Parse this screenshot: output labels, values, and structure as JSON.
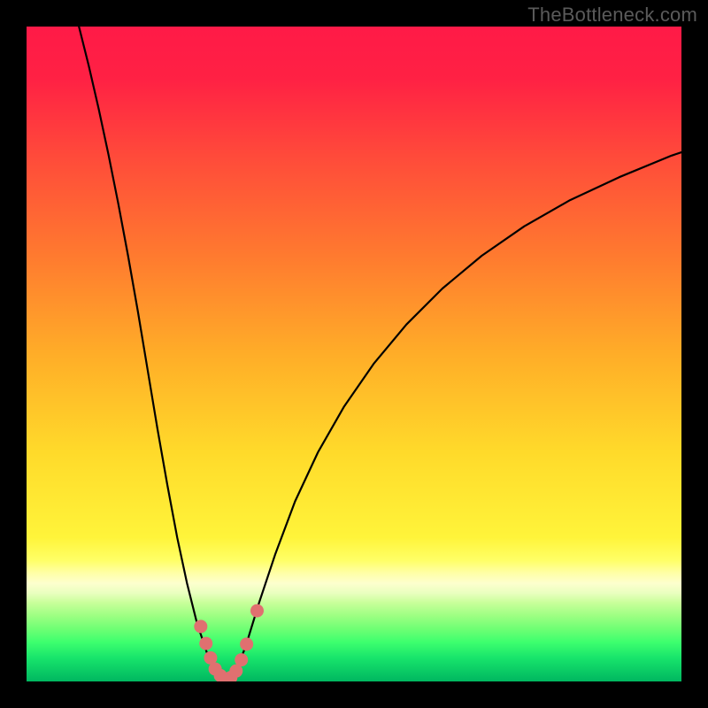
{
  "watermark": "TheBottleneck.com",
  "chart_data": {
    "type": "line",
    "title": "",
    "xlabel": "",
    "ylabel": "",
    "xlim": [
      0,
      100
    ],
    "ylim": [
      0,
      100
    ],
    "grid": false,
    "legend": false,
    "background_gradient": {
      "stops": [
        {
          "offset": 0.0,
          "color": "#ff1a47"
        },
        {
          "offset": 0.08,
          "color": "#ff2144"
        },
        {
          "offset": 0.2,
          "color": "#ff4b3a"
        },
        {
          "offset": 0.35,
          "color": "#ff7a2f"
        },
        {
          "offset": 0.5,
          "color": "#ffad28"
        },
        {
          "offset": 0.65,
          "color": "#ffda2a"
        },
        {
          "offset": 0.78,
          "color": "#fff43a"
        },
        {
          "offset": 0.815,
          "color": "#ffff66"
        },
        {
          "offset": 0.835,
          "color": "#ffffa8"
        },
        {
          "offset": 0.85,
          "color": "#fdffce"
        },
        {
          "offset": 0.865,
          "color": "#e9ffbf"
        },
        {
          "offset": 0.88,
          "color": "#c8ff9a"
        },
        {
          "offset": 0.9,
          "color": "#9cff82"
        },
        {
          "offset": 0.92,
          "color": "#6eff74"
        },
        {
          "offset": 0.94,
          "color": "#3dff6e"
        },
        {
          "offset": 0.965,
          "color": "#17e36b"
        },
        {
          "offset": 1.0,
          "color": "#00b760"
        }
      ]
    },
    "series": [
      {
        "name": "left-curve",
        "stroke": "#000000",
        "stroke_width": 2.2,
        "points": [
          {
            "x": 8.0,
            "y": 100.0
          },
          {
            "x": 9.5,
            "y": 94.0
          },
          {
            "x": 11.0,
            "y": 87.5
          },
          {
            "x": 12.5,
            "y": 80.5
          },
          {
            "x": 14.0,
            "y": 73.0
          },
          {
            "x": 15.5,
            "y": 65.0
          },
          {
            "x": 17.0,
            "y": 56.5
          },
          {
            "x": 18.5,
            "y": 47.5
          },
          {
            "x": 20.0,
            "y": 38.5
          },
          {
            "x": 21.5,
            "y": 30.0
          },
          {
            "x": 23.0,
            "y": 22.0
          },
          {
            "x": 24.5,
            "y": 15.0
          },
          {
            "x": 26.0,
            "y": 9.0
          },
          {
            "x": 27.5,
            "y": 4.5
          },
          {
            "x": 29.0,
            "y": 1.5
          },
          {
            "x": 30.5,
            "y": 0.2
          }
        ]
      },
      {
        "name": "right-curve",
        "stroke": "#000000",
        "stroke_width": 2.2,
        "points": [
          {
            "x": 30.5,
            "y": 0.2
          },
          {
            "x": 32.0,
            "y": 1.5
          },
          {
            "x": 33.5,
            "y": 5.5
          },
          {
            "x": 35.5,
            "y": 12.0
          },
          {
            "x": 38.0,
            "y": 19.5
          },
          {
            "x": 41.0,
            "y": 27.5
          },
          {
            "x": 44.5,
            "y": 35.0
          },
          {
            "x": 48.5,
            "y": 42.0
          },
          {
            "x": 53.0,
            "y": 48.5
          },
          {
            "x": 58.0,
            "y": 54.5
          },
          {
            "x": 63.5,
            "y": 60.0
          },
          {
            "x": 69.5,
            "y": 65.0
          },
          {
            "x": 76.0,
            "y": 69.5
          },
          {
            "x": 83.0,
            "y": 73.5
          },
          {
            "x": 90.5,
            "y": 77.0
          },
          {
            "x": 98.5,
            "y": 80.3
          },
          {
            "x": 100.0,
            "y": 80.8
          }
        ]
      }
    ],
    "markers": {
      "name": "bottom-dots",
      "fill": "#e07070",
      "radius": 7.5,
      "points": [
        {
          "x": 26.6,
          "y": 8.4
        },
        {
          "x": 27.4,
          "y": 5.8
        },
        {
          "x": 28.1,
          "y": 3.6
        },
        {
          "x": 28.8,
          "y": 1.9
        },
        {
          "x": 29.6,
          "y": 0.9
        },
        {
          "x": 30.4,
          "y": 0.4
        },
        {
          "x": 31.2,
          "y": 0.6
        },
        {
          "x": 32.0,
          "y": 1.6
        },
        {
          "x": 32.8,
          "y": 3.3
        },
        {
          "x": 33.6,
          "y": 5.7
        },
        {
          "x": 35.2,
          "y": 10.8
        }
      ]
    }
  }
}
